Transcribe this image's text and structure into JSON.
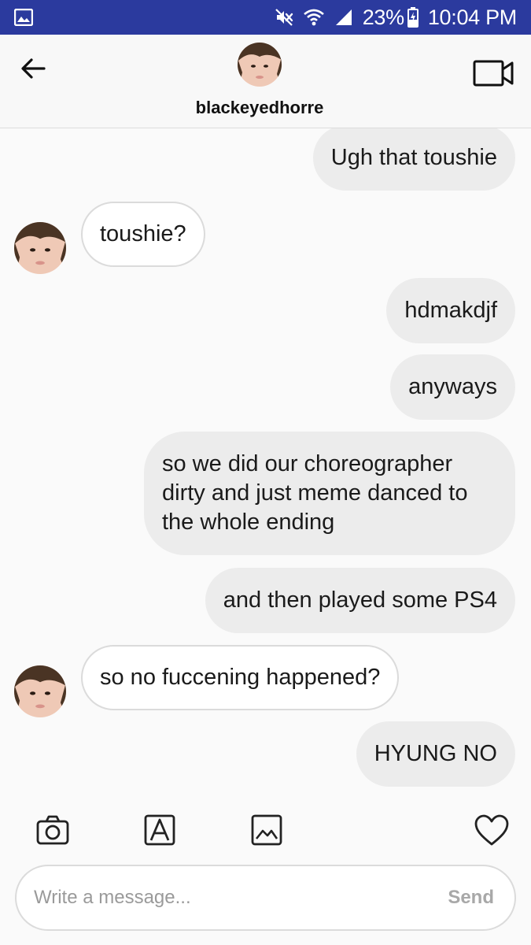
{
  "status": {
    "battery": "23%",
    "time": "10:04 PM"
  },
  "header": {
    "username": "blackeyedhorre"
  },
  "messages": [
    {
      "type": "sent",
      "text": "Ugh that toushie"
    },
    {
      "type": "received",
      "text": "toushie?"
    },
    {
      "type": "sent",
      "text": "hdmakdjf"
    },
    {
      "type": "sent",
      "text": "anyways"
    },
    {
      "type": "sent",
      "text": "so we did our choreographer dirty and just meme danced to the whole ending"
    },
    {
      "type": "sent",
      "text": "and then played some PS4"
    },
    {
      "type": "received",
      "text": "so no fuccening happened?"
    },
    {
      "type": "sent",
      "text": "HYUNG NO"
    }
  ],
  "composer": {
    "placeholder": "Write a message...",
    "send_label": "Send"
  },
  "icons": {
    "status_left": "image-icon",
    "mute": "mute-icon",
    "wifi": "wifi-icon",
    "signal": "signal-icon",
    "battery": "battery-charging-icon",
    "back": "back-arrow-icon",
    "video": "video-camera-icon",
    "camera": "camera-icon",
    "font": "text-style-icon",
    "gallery": "gallery-icon",
    "heart": "heart-icon"
  },
  "colors": {
    "status_bar": "#2b3a9e",
    "sent_bubble": "#ececec",
    "received_bubble": "#ffffff",
    "background": "#fafafa"
  }
}
